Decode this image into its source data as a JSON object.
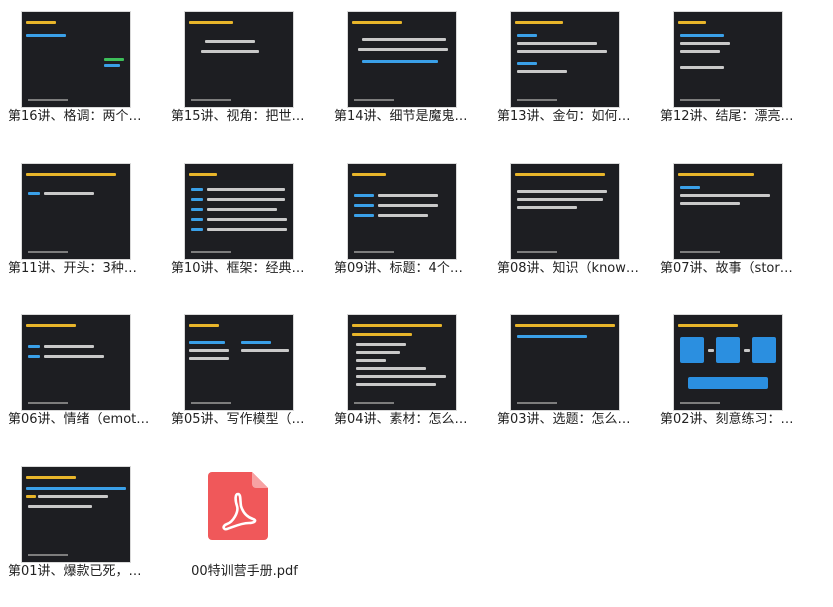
{
  "files": [
    {
      "label": "第16讲、格调：两个…",
      "type": "video"
    },
    {
      "label": "第15讲、视角：把世…",
      "type": "video"
    },
    {
      "label": "第14讲、细节是魔鬼…",
      "type": "video"
    },
    {
      "label": "第13讲、金句：如何…",
      "type": "video"
    },
    {
      "label": "第12讲、结尾：漂亮…",
      "type": "video"
    },
    {
      "label": "第11讲、开头：3种…",
      "type": "video"
    },
    {
      "label": "第10讲、框架：经典…",
      "type": "video"
    },
    {
      "label": "第09讲、标题：4个…",
      "type": "video"
    },
    {
      "label": "第08讲、知识（know…",
      "type": "video"
    },
    {
      "label": "第07讲、故事（stor…",
      "type": "video"
    },
    {
      "label": "第06讲、情绪（emot…",
      "type": "video"
    },
    {
      "label": "第05讲、写作模型（…",
      "type": "video"
    },
    {
      "label": "第04讲、素材：怎么…",
      "type": "video"
    },
    {
      "label": "第03讲、选题：怎么…",
      "type": "video"
    },
    {
      "label": "第02讲、刻意练习：…",
      "type": "video"
    },
    {
      "label": "第01讲、爆款已死，…",
      "type": "video"
    },
    {
      "label": "00特训营手册.pdf",
      "type": "pdf"
    }
  ],
  "colors": {
    "thumb_bg": "#1d1e22",
    "pdf_red": "#f0585a",
    "caption": "#222222"
  }
}
